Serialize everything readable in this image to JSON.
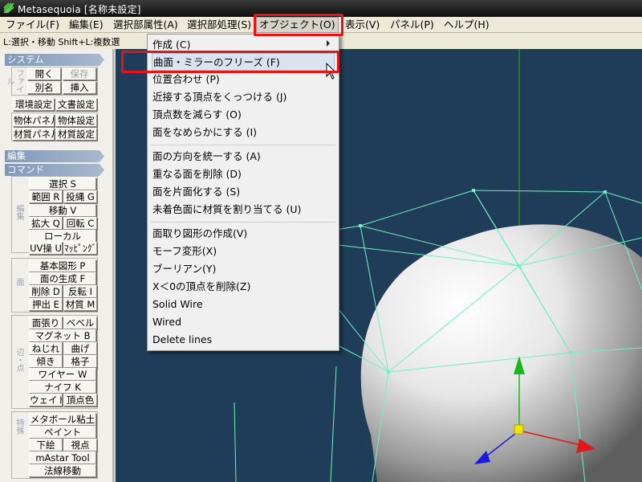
{
  "window": {
    "title": "Metasequoia [名称未設定]"
  },
  "menubar": {
    "items": [
      "ファイル(F)",
      "編集(E)",
      "選択部属性(A)",
      "選択部処理(S)",
      "オブジェクト(O)",
      "表示(V)",
      "パネル(P)",
      "ヘルプ(H)"
    ]
  },
  "hintbar": {
    "text": "L:選択・移動  Shift+L:複数選"
  },
  "left_panel": {
    "system": {
      "title": "システム",
      "file_label": "ファイル",
      "open": "開く",
      "save": "保存",
      "save_as": "別名",
      "insert": "挿入",
      "env": "環境設定",
      "doc": "文書設定",
      "obj_panel": "物体パネル",
      "obj_settings": "物体設定",
      "mat_panel": "材質パネル",
      "mat_settings": "材質設定"
    },
    "edit": {
      "title": "編集"
    },
    "command": {
      "title": "コマンド",
      "edit_label": "編集",
      "select": "選択 S",
      "range": "範囲 R",
      "lasso": "投縄 G",
      "move": "移動 V",
      "scale": "拡大 Q",
      "rotate": "回転 C",
      "local": "ローカル",
      "uv": "UV操 U",
      "mapping": "ﾏｯﾋﾟﾝｸﾞ",
      "face_label": "面",
      "basic_shape": "基本図形 P",
      "face_gen": "面の生成 F",
      "delete": "削除 D",
      "flip": "反転 I",
      "extrude": "押出 E",
      "material": "材質 M",
      "edge_label": "辺・点",
      "stretch": "面張り",
      "bevel": "ベベル",
      "magnet": "マグネット B",
      "twist": "ねじれ",
      "bend": "曲げ",
      "tilt": "傾き",
      "lattice": "格子",
      "wire": "ワイヤー W",
      "knife": "ナイフ K",
      "weight": "ウェイト",
      "vertex_color": "頂点色",
      "special_label": "特殊",
      "metaball": "メタボール粘土",
      "paint": "ペイント",
      "underlay": "下絵",
      "viewpoint": "視点",
      "mastar": "mAstar Tool",
      "normal_move": "法線移動"
    }
  },
  "dropdown": {
    "items": [
      "作成 (C)",
      "曲面・ミラーのフリーズ (F)",
      "位置合わせ (P)",
      "近接する頂点をくっつける (J)",
      "頂点数を減らす (O)",
      "面をなめらかにする (I)",
      "面の方向を統一する (A)",
      "重なる面を削除 (D)",
      "面を片面化する (S)",
      "未着色面に材質を割り当てる (U)",
      "面取り図形の作成(V)",
      "モーフ変形(X)",
      "ブーリアン(Y)",
      "X＜0の頂点を削除(Z)",
      "Solid Wire",
      "Wired",
      "Delete lines"
    ],
    "highlighted_index": 1
  },
  "colors": {
    "viewport_bg": "#1f3d58",
    "wire": "#6ff0c2",
    "axis_green": "#1ab81a",
    "axis_red": "#e01818",
    "axis_blue": "#1a1ae0",
    "handle_yellow": "#f2e600",
    "annotation_red": "#e81414"
  },
  "icons": [
    "metasequoia-logo-icon",
    "submenu-arrow-icon",
    "mouse-cursor-icon"
  ]
}
